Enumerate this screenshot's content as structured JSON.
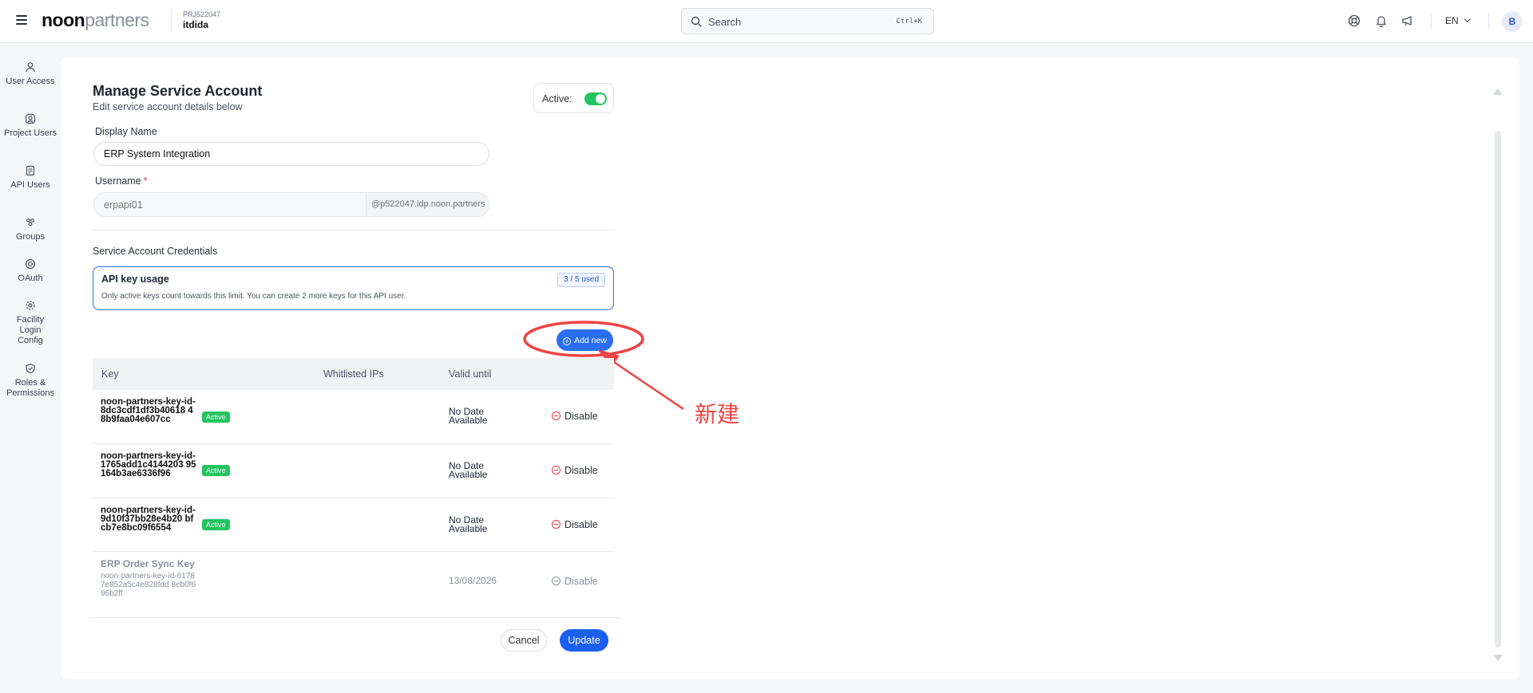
{
  "header": {
    "logo_bold": "noon",
    "logo_light": "partners",
    "project_id": "PRJ522047",
    "project_name": "itdida",
    "search_placeholder": "Search",
    "search_shortcut": "Ctrl+K",
    "language": "EN",
    "avatar_initial": "B"
  },
  "sidebar": {
    "items": [
      {
        "label": "User Access",
        "icon": "user-icon"
      },
      {
        "label": "Project Users",
        "icon": "project-users-icon"
      },
      {
        "label": "API Users",
        "icon": "api-doc-icon"
      },
      {
        "label": "Groups",
        "icon": "groups-icon"
      },
      {
        "label": "OAuth",
        "icon": "oauth-icon"
      },
      {
        "label": "Facility Login Config",
        "icon": "gear-icon"
      },
      {
        "label": "Roles & Permissions",
        "icon": "shield-check-icon"
      }
    ]
  },
  "form": {
    "title": "Manage Service Account",
    "subtitle": "Edit service account details below",
    "active_label": "Active:",
    "active": true,
    "display_name_label": "Display Name",
    "display_name_value": "ERP System Integration",
    "username_label": "Username",
    "username_required": "*",
    "username_placeholder": "erpapi01",
    "username_suffix": "@p522047.idp.noon.partners",
    "credentials_title": "Service Account Credentials"
  },
  "usage": {
    "title": "API key usage",
    "description": "Only active keys count towards this limit. You can create 2 more keys for this API user.",
    "badge": "3 / 5 used"
  },
  "add_new_label": "Add new",
  "annotation_text": "新建",
  "table": {
    "headers": [
      "Key",
      "Whitlisted IPs",
      "Valid until"
    ],
    "rows": [
      {
        "key": "noon-partners-key-id-8dc3cdf1df3b40618 48b9faa04e607cc",
        "status": "Active",
        "valid_until": "No Date Available",
        "action": "Disable"
      },
      {
        "key": "noon-partners-key-id-1765add1c4144203 95164b3ae6336f96",
        "status": "Active",
        "valid_until": "No Date Available",
        "action": "Disable"
      },
      {
        "key": "noon-partners-key-id-9d10f37bb28e4b20 bfcb7e8bc09f6554",
        "status": "Active",
        "valid_until": "No Date Available",
        "action": "Disable"
      }
    ],
    "inactive_row": {
      "title": "ERP Order Sync Key",
      "key": "noon-partners-key-id-61787e852a5c4e828fdd 8eb0f696b2ff",
      "valid_until": "13/08/2026",
      "action": "Disable"
    }
  },
  "footer": {
    "cancel_label": "Cancel",
    "update_label": "Update"
  },
  "colors": {
    "primary": "#2a6ff2",
    "active_green": "#22c55e",
    "annotation_red": "#ef4444"
  }
}
